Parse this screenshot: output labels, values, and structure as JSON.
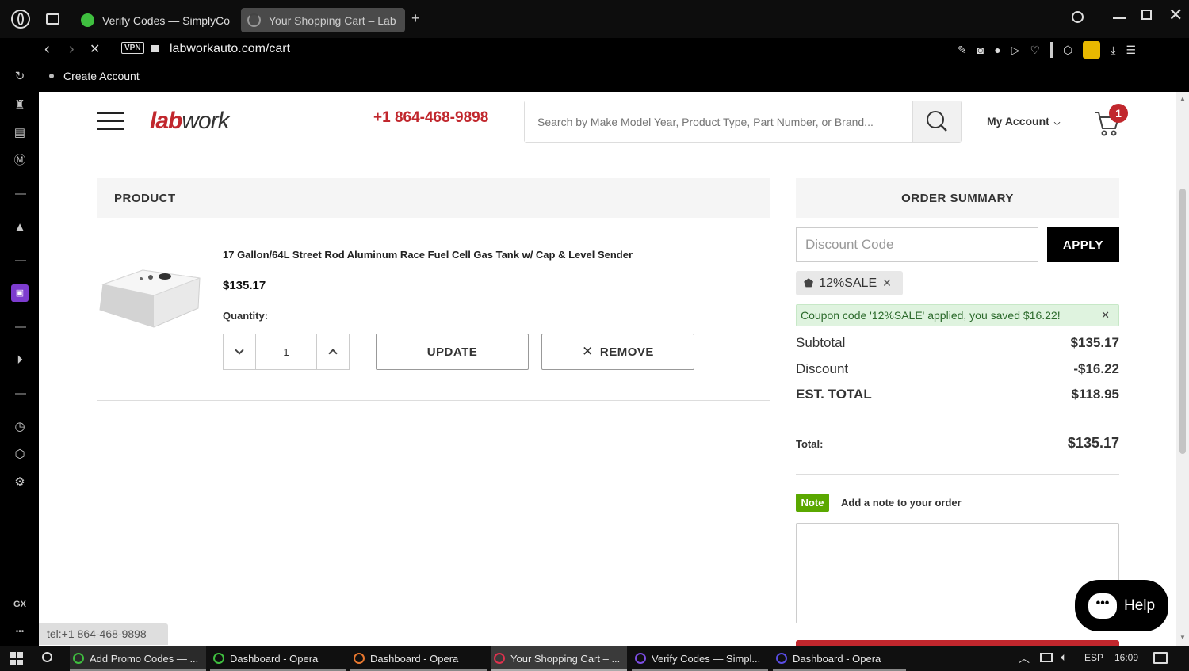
{
  "browser": {
    "tabs": [
      {
        "title": "Verify Codes — SimplyCo",
        "active": false
      },
      {
        "title": "Your Shopping Cart – Lab",
        "active": true
      }
    ],
    "new_tab": "+",
    "vpn_label": "VPN",
    "url": "labworkauto.com/cart",
    "bookmark": "Create Account",
    "sidebar_gx": "GX",
    "sidebar_more": "•••"
  },
  "header": {
    "logo_first": "lab",
    "logo_rest": "work",
    "phone": "+1 864-468-9898",
    "search_placeholder": "Search by Make Model Year, Product Type, Part Number, or Brand...",
    "account_label": "My Account",
    "cart_count": "1"
  },
  "cart": {
    "product_header": "PRODUCT",
    "item": {
      "title": "17 Gallon/64L Street Rod Aluminum Race Fuel Cell Gas Tank w/ Cap & Level Sender",
      "price": "$135.17",
      "quantity_label": "Quantity:",
      "quantity": "1"
    },
    "update_label": "UPDATE",
    "remove_label": "REMOVE"
  },
  "summary": {
    "title": "ORDER SUMMARY",
    "discount_placeholder": "Discount Code",
    "apply_label": "APPLY",
    "coupon_chip": "12%SALE",
    "coupon_message": "Coupon code '12%SALE' applied, you saved $16.22!",
    "subtotal_label": "Subtotal",
    "subtotal_value": "$135.17",
    "discount_label": "Discount",
    "discount_value": "-$16.22",
    "est_total_label": "EST. TOTAL",
    "est_total_value": "$118.95",
    "total_label": "Total:",
    "total_value": "$135.17",
    "note_badge": "Note",
    "note_label": "Add a note to your order"
  },
  "help_label": "Help",
  "status_link": "tel:+1 864-468-9898",
  "taskbar": {
    "items": [
      {
        "label": "Add Promo Codes — ...",
        "color": "#3fbf3f"
      },
      {
        "label": "Dashboard - Opera",
        "color": "#3fbf3f"
      },
      {
        "label": "Dashboard - Opera",
        "color": "#e8772e"
      },
      {
        "label": "Your Shopping Cart – ...",
        "color": "#e0314d"
      },
      {
        "label": "Verify Codes — Simpl...",
        "color": "#7d4de6"
      },
      {
        "label": "Dashboard - Opera",
        "color": "#5a4de6"
      }
    ],
    "language": "ESP",
    "time": "16:09"
  },
  "colors": {
    "brand_red": "#c1272d",
    "note_green": "#5aa800",
    "coupon_bg": "#dff3df"
  }
}
